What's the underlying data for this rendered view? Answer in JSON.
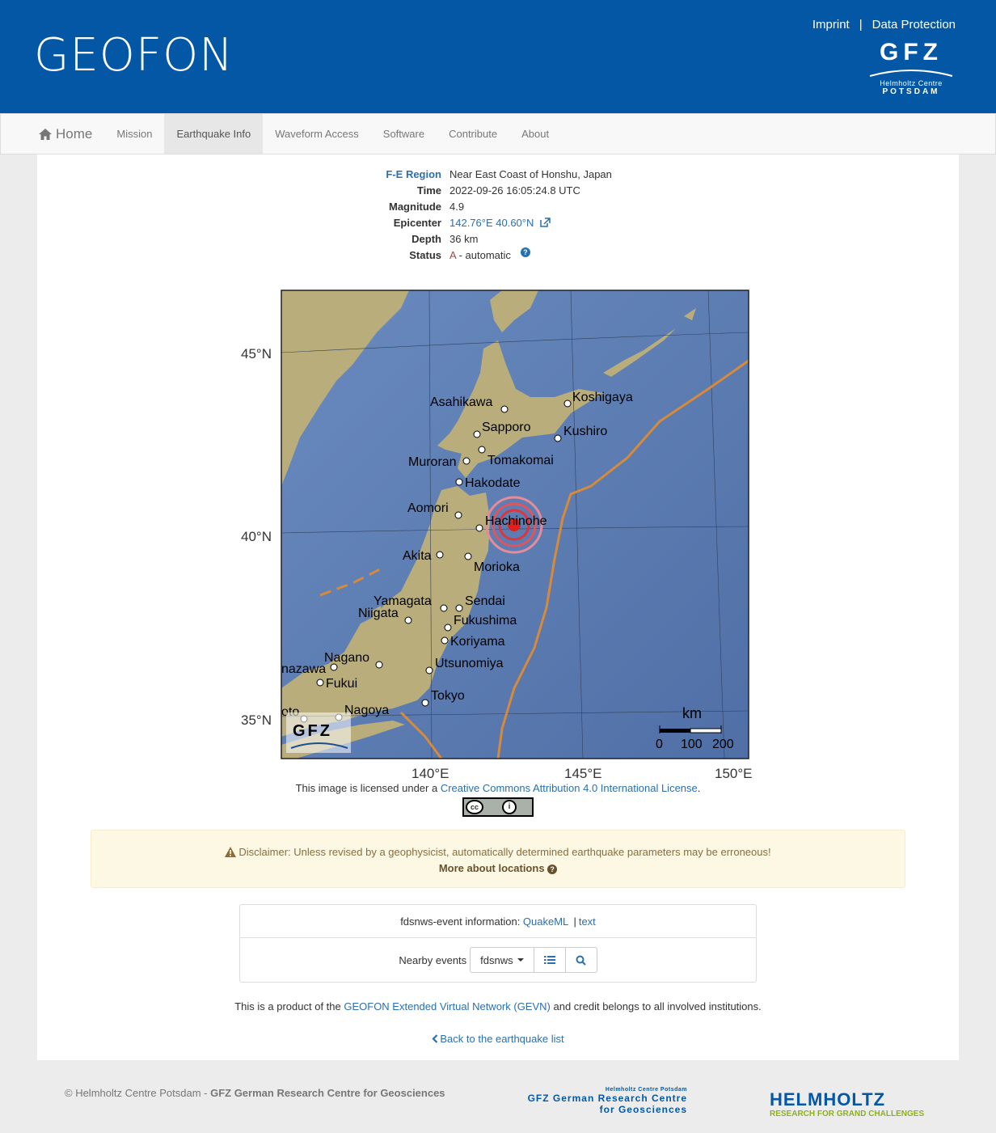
{
  "header": {
    "brand": "GEOFON",
    "links": [
      "Imprint",
      "Data Protection"
    ],
    "separator": "|",
    "logo": {
      "name": "GFZ",
      "line1": "Helmholtz Centre",
      "line2": "POTSDAM"
    }
  },
  "nav": {
    "home": "Home",
    "items": [
      "Mission",
      "Earthquake Info",
      "Waveform Access",
      "Software",
      "Contribute",
      "About"
    ],
    "active": "Earthquake Info"
  },
  "event": {
    "labels": {
      "region": "F-E Region",
      "time": "Time",
      "magnitude": "Magnitude",
      "epicenter": "Epicenter",
      "depth": "Depth",
      "status": "Status"
    },
    "region": "Near East Coast of Honshu, Japan",
    "time": "2022-09-26 16:05:24.8 UTC",
    "magnitude": "4.9",
    "epicenter": "142.76°E 40.60°N",
    "depth": "36 km",
    "status_code": "A",
    "status_text": " - automatic"
  },
  "map": {
    "lat_labels": [
      "45°N",
      "40°N",
      "35°N"
    ],
    "lon_labels": [
      "140°E",
      "145°E",
      "150°E"
    ],
    "cities": [
      "Asahikawa",
      "Koshigaya",
      "Sapporo",
      "Kushiro",
      "Muroran",
      "Tomakomai",
      "Hakodate",
      "Aomori",
      "Hachinohe",
      "Akita",
      "Morioka",
      "Yamagata",
      "Sendai",
      "Niigata",
      "Fukushima",
      "Koriyama",
      "Nagano",
      "Utsunomiya",
      "nazawa",
      "Fukui",
      "Tokyo",
      "oto",
      "Nagoya"
    ],
    "scale": {
      "unit": "km",
      "ticks": [
        "0",
        "100",
        "200"
      ]
    },
    "watermark": "GFZ",
    "colors": {
      "ocean": "#5d7fb4",
      "land": "#b7ae7e",
      "plate_boundary": "#d68a3a",
      "event": "#e0201c"
    }
  },
  "license": {
    "prefix": "This image is licensed under a ",
    "link": "Creative Commons Attribution 4.0 International License",
    "suffix": ".",
    "badge_cc": "cc",
    "badge_by": "i"
  },
  "disclaimer": {
    "text": "Disclaimer: Unless revised by a geophysicist, automatically determined earthquake parameters may be erroneous!",
    "more": "More about locations"
  },
  "fdsn": {
    "prefix": "fdsnws-event information: ",
    "quakeml": "QuakeML",
    "sep": "|",
    "text": "text",
    "nearby_label": "Nearby events",
    "dropdown": "fdsnws"
  },
  "product": {
    "prefix": "This is a product of the ",
    "link": "GEOFON Extended Virtual Network (GEVN)",
    "suffix": " and credit belongs to all involved institutions."
  },
  "back": "Back to the earthquake list",
  "footer": {
    "copyright": "© Helmholtz Centre Potsdam - ",
    "copyright_bold": "GFZ German Research Centre for Geosciences",
    "gfz_small": "Helmholtz Centre Potsdam",
    "gfz_line1": "GFZ German Research Centre",
    "gfz_line2": "for Geosciences",
    "helmholtz": "HELMHOLTZ",
    "helmholtz_tag": "RESEARCH FOR GRAND CHALLENGES"
  }
}
